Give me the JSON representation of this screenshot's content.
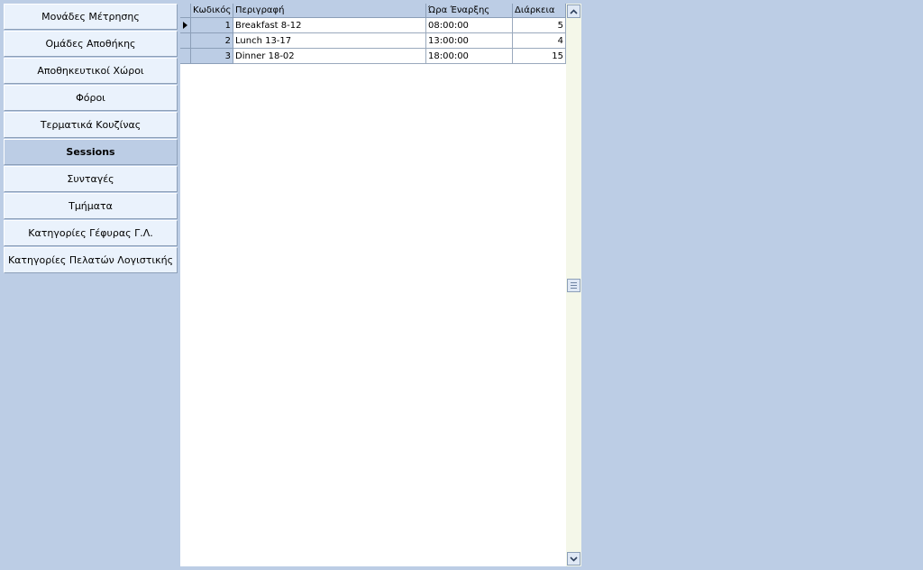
{
  "sidebar": {
    "items": [
      {
        "label": "Μονάδες Μέτρησης"
      },
      {
        "label": "Ομάδες Αποθήκης"
      },
      {
        "label": "Αποθηκευτικοί Χώροι"
      },
      {
        "label": "Φόροι"
      },
      {
        "label": "Τερματικά Κουζίνας"
      },
      {
        "label": "Sessions",
        "active": true
      },
      {
        "label": "Συνταγές"
      },
      {
        "label": "Τμήματα"
      },
      {
        "label": "Κατηγορίες Γέφυρας Γ.Λ."
      },
      {
        "label": "Κατηγορίες Πελατών Λογιστικής"
      }
    ]
  },
  "grid": {
    "columns": {
      "code": "Κωδικός",
      "description": "Περιγραφή",
      "start_time": "Ώρα Έναρξης",
      "duration": "Διάρκεια"
    },
    "rows": [
      {
        "code": "1",
        "description": "Breakfast 8-12",
        "start_time": "08:00:00",
        "duration": "5",
        "current": true
      },
      {
        "code": "2",
        "description": "Lunch 13-17",
        "start_time": "13:00:00",
        "duration": "4"
      },
      {
        "code": "3",
        "description": "Dinner 18-02",
        "start_time": "18:00:00",
        "duration": "15"
      }
    ]
  },
  "icons": {
    "row_indicator": "current-row-arrow-icon",
    "scroll_up": "chevron-up-icon",
    "scroll_down": "chevron-down-icon"
  },
  "colors": {
    "background": "#bccde5",
    "button": "#eaf2fc",
    "grid": "#ffffff"
  }
}
